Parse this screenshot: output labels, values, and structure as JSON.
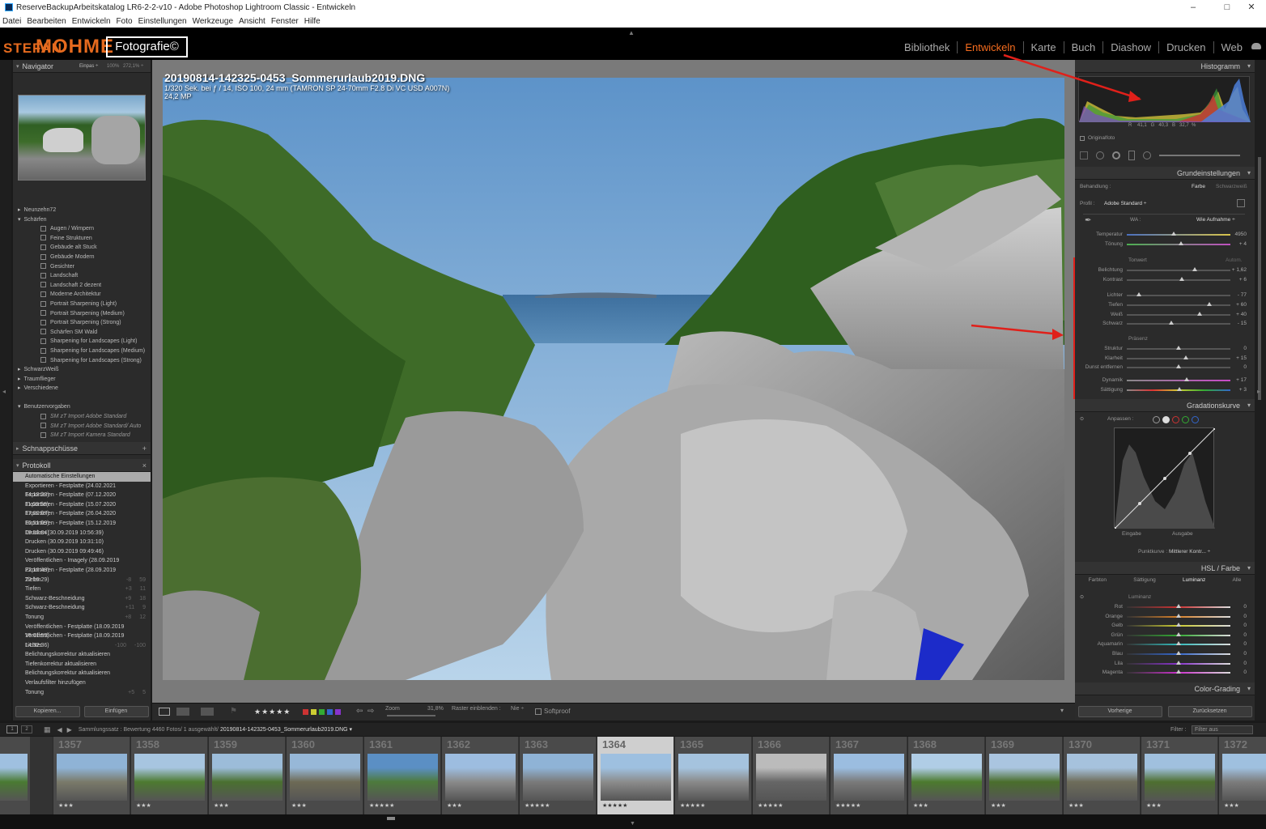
{
  "window": {
    "title": "ReserveBackupArbeitskatalog LR6-2-2-v10 - Adobe Photoshop Lightroom Classic - Entwickeln",
    "controls": [
      "–",
      "□",
      "✕"
    ]
  },
  "menu": [
    "Datei",
    "Bearbeiten",
    "Entwickeln",
    "Foto",
    "Einstellungen",
    "Werkzeuge",
    "Ansicht",
    "Fenster",
    "Hilfe"
  ],
  "logo": {
    "part1": "STEFAN",
    "part2": "MOHME",
    "part3": "Fotografie©"
  },
  "modules": [
    {
      "label": "Bibliothek",
      "active": false
    },
    {
      "label": "Entwickeln",
      "active": true
    },
    {
      "label": "Karte",
      "active": false
    },
    {
      "label": "Buch",
      "active": false
    },
    {
      "label": "Diashow",
      "active": false
    },
    {
      "label": "Drucken",
      "active": false
    },
    {
      "label": "Web",
      "active": false
    }
  ],
  "navigator": {
    "title": "Navigator",
    "zoom": [
      "Einpas ÷",
      "100%",
      "272,1% ÷"
    ]
  },
  "presets": [
    {
      "label": "Neunzehn72",
      "level": 1,
      "exp": "▸"
    },
    {
      "label": "Schärfen",
      "level": 1,
      "exp": "▾"
    },
    {
      "label": "Augen / Wimpern",
      "level": 2
    },
    {
      "label": "Feine Strukturen",
      "level": 2
    },
    {
      "label": "Gebäude alt Stuck",
      "level": 2
    },
    {
      "label": "Gebäude Modern",
      "level": 2
    },
    {
      "label": "Gesichter",
      "level": 2
    },
    {
      "label": "Landschaft",
      "level": 2
    },
    {
      "label": "Landschaft 2 dezent",
      "level": 2
    },
    {
      "label": "Moderne Architektur",
      "level": 2
    },
    {
      "label": "Portrait Sharpening (Light)",
      "level": 2
    },
    {
      "label": "Portrait Sharpening (Medium)",
      "level": 2
    },
    {
      "label": "Portrait Sharpening (Strong)",
      "level": 2
    },
    {
      "label": "Schärfen SM Wald",
      "level": 2
    },
    {
      "label": "Sharpening for Landscapes (Light)",
      "level": 2
    },
    {
      "label": "Sharpening for Landscapes (Medium)",
      "level": 2
    },
    {
      "label": "Sharpening for Landscapes (Strong)",
      "level": 2
    },
    {
      "label": "SchwarzWeiß",
      "level": 1,
      "exp": "▸"
    },
    {
      "label": "Traumflieger",
      "level": 1,
      "exp": "▸"
    },
    {
      "label": "Verschiedene",
      "level": 1,
      "exp": "▸"
    },
    {
      "label": "",
      "level": 0
    },
    {
      "label": "Benutzervorgaben",
      "level": 1,
      "exp": "▾"
    },
    {
      "label": "SM zT Import Adobe Standard",
      "level": 2,
      "italic": true
    },
    {
      "label": "SM zT Import Adobe Standard/ Auto",
      "level": 2,
      "italic": true
    },
    {
      "label": "SM zT Import Kamera Standard",
      "level": 2,
      "italic": true
    }
  ],
  "snapshots": {
    "title": "Schnappschüsse",
    "add": "+"
  },
  "history": {
    "title": "Protokoll",
    "close": "×",
    "items": [
      {
        "label": "Automatische Einstellungen",
        "a": "",
        "b": "",
        "sel": true
      },
      {
        "label": "Exportieren - Festplatte (24.02.2021 14:18:22)",
        "a": "",
        "b": ""
      },
      {
        "label": "Exportieren - Festplatte (07.12.2020 11:08:58)",
        "a": "",
        "b": ""
      },
      {
        "label": "Exportieren - Festplatte (15.07.2020 17:00:07)",
        "a": "",
        "b": ""
      },
      {
        "label": "Exportieren - Festplatte (26.04.2020 10:51:09)",
        "a": "",
        "b": ""
      },
      {
        "label": "Exportieren - Festplatte (15.12.2019 19:50:04)",
        "a": "",
        "b": ""
      },
      {
        "label": "Drucken (30.09.2019 10:56:39)",
        "a": "",
        "b": ""
      },
      {
        "label": "Drucken (30.09.2019 10:31:10)",
        "a": "",
        "b": ""
      },
      {
        "label": "Drucken (30.09.2019 09:49:46)",
        "a": "",
        "b": ""
      },
      {
        "label": "Veröffentlichen - Imagely (28.09.2019 22:16:48)",
        "a": "",
        "b": ""
      },
      {
        "label": "Exportieren - Festplatte (28.09.2019 22:16:29)",
        "a": "",
        "b": ""
      },
      {
        "label": "Tiefen",
        "a": "-8",
        "b": "59"
      },
      {
        "label": "Tiefen",
        "a": "+3",
        "b": "11"
      },
      {
        "label": "Schwarz-Beschneidung",
        "a": "+9",
        "b": "18"
      },
      {
        "label": "Schwarz-Beschneidung",
        "a": "+11",
        "b": "9"
      },
      {
        "label": "Tonung",
        "a": "+8",
        "b": "12"
      },
      {
        "label": "Veröffentlichen - Festplatte (18.09.2019 16:01:55)",
        "a": "",
        "b": ""
      },
      {
        "label": "Veröffentlichen - Festplatte (18.09.2019 14:32:36)",
        "a": "",
        "b": ""
      },
      {
        "label": "Lichter",
        "a": "-100",
        "b": "-100"
      },
      {
        "label": "Belichtungskorrektur aktualisieren",
        "a": "",
        "b": ""
      },
      {
        "label": "Tiefenkorrektur aktualisieren",
        "a": "",
        "b": ""
      },
      {
        "label": "Belichtungskorrektur aktualisieren",
        "a": "",
        "b": ""
      },
      {
        "label": "Verlaufsfilter hinzufügen",
        "a": "",
        "b": ""
      },
      {
        "label": "Tonung",
        "a": "+5",
        "b": "5"
      }
    ]
  },
  "leftButtons": [
    "Kopieren...",
    "Einfügen"
  ],
  "photo": {
    "filename": "20190814-142325-0453_Sommerurlaub2019.DNG",
    "exif": "1/320 Sek. bei ƒ / 14, ISO 100, 24 mm (TAMRON SP 24-70mm F2.8 Di VC USD A007N)",
    "mp": "24,2 MP"
  },
  "toolbar": {
    "stars": "★★★★★",
    "zoomLabel": "Zoom",
    "zoomValue": "31,8%",
    "grid": "Raster einblenden :",
    "gridVal": "Nie ÷",
    "softproof": "Softproof"
  },
  "histogram": {
    "title": "Histogramm",
    "readout": "R    41,1   G   40,3   B   32,7  %",
    "original": "Originalfoto"
  },
  "basic": {
    "title": "Grundeinstellungen",
    "treatment": "Behandlung :",
    "farbe": "Farbe",
    "sw": "Schwarzweiß",
    "profileLabel": "Profil :",
    "profile": "Adobe Standard ÷",
    "wbLabel": "WA :",
    "wb": "Wie Aufnahme ÷",
    "tonwert": "Tonwert",
    "auto": "Autom.",
    "praesenz": "Präsenz",
    "sliders": [
      {
        "label": "Temperatur",
        "value": "4950",
        "pos": 0.45
      },
      {
        "label": "Tönung",
        "value": "+ 4",
        "pos": 0.52
      },
      {
        "label": "Belichtung",
        "value": "+ 1,62",
        "pos": 0.66
      },
      {
        "label": "Kontrast",
        "value": "+ 6",
        "pos": 0.53
      },
      {
        "label": "Lichter",
        "value": "- 77",
        "pos": 0.12
      },
      {
        "label": "Tiefen",
        "value": "+ 60",
        "pos": 0.8
      },
      {
        "label": "Weiß",
        "value": "+ 40",
        "pos": 0.7
      },
      {
        "label": "Schwarz",
        "value": "- 15",
        "pos": 0.43
      },
      {
        "label": "Struktur",
        "value": "0",
        "pos": 0.5
      },
      {
        "label": "Klarheit",
        "value": "+ 15",
        "pos": 0.57
      },
      {
        "label": "Dunst entfernen",
        "value": "0",
        "pos": 0.5
      },
      {
        "label": "Dynamik",
        "value": "+ 17",
        "pos": 0.58
      },
      {
        "label": "Sättigung",
        "value": "+ 3",
        "pos": 0.51
      }
    ]
  },
  "curve": {
    "title": "Gradationskurve",
    "adjust": "Anpassen :",
    "input": "Eingabe",
    "output": "Ausgabe",
    "pointcurve": "Punktkurve :",
    "pointcurveVal": "Mittlerer Kontr... ÷"
  },
  "hsl": {
    "title": "HSL / Farbe",
    "tabs": [
      "Farbton",
      "Sättigung",
      "Luminanz",
      "Alle"
    ],
    "group": "Luminanz",
    "sliders": [
      {
        "label": "Rot",
        "value": "0"
      },
      {
        "label": "Orange",
        "value": "0"
      },
      {
        "label": "Gelb",
        "value": "0"
      },
      {
        "label": "Grün",
        "value": "0"
      },
      {
        "label": "Aquamarin",
        "value": "0"
      },
      {
        "label": "Blau",
        "value": "0"
      },
      {
        "label": "Lila",
        "value": "0"
      },
      {
        "label": "Magenta",
        "value": "0"
      }
    ]
  },
  "colorgrading": {
    "title": "Color-Grading"
  },
  "rightButtons": [
    "Vorherige",
    "Zurücksetzen"
  ],
  "filmbar": {
    "info": "Sammlungssatz : Bewertung   4460 Fotos/ 1 ausgewählt/",
    "file": "20190814-142325-0453_Sommerurlaub2019.DNG ▾",
    "filterLabel": "Filter :",
    "filterValue": "Filter aus"
  },
  "filmstrip": [
    {
      "num": "",
      "stars": "",
      "sel": false
    },
    {
      "num": "1357",
      "stars": "★★★",
      "sel": false
    },
    {
      "num": "1358",
      "stars": "★★★",
      "sel": false
    },
    {
      "num": "1359",
      "stars": "★★★",
      "sel": false
    },
    {
      "num": "1360",
      "stars": "★★★",
      "sel": false
    },
    {
      "num": "1361",
      "stars": "★★★★★",
      "sel": false
    },
    {
      "num": "1362",
      "stars": "★★★",
      "sel": false
    },
    {
      "num": "1363",
      "stars": "★★★★★",
      "sel": false
    },
    {
      "num": "1364",
      "stars": "★★★★★",
      "sel": true
    },
    {
      "num": "1365",
      "stars": "★★★★★",
      "sel": false
    },
    {
      "num": "1366",
      "stars": "★★★★★",
      "sel": false
    },
    {
      "num": "1367",
      "stars": "★★★★★",
      "sel": false
    },
    {
      "num": "1368",
      "stars": "★★★",
      "sel": false
    },
    {
      "num": "1369",
      "stars": "★★★",
      "sel": false
    },
    {
      "num": "1370",
      "stars": "★★★",
      "sel": false
    },
    {
      "num": "1371",
      "stars": "★★★",
      "sel": false
    },
    {
      "num": "1372",
      "stars": "★★★",
      "sel": false
    }
  ]
}
